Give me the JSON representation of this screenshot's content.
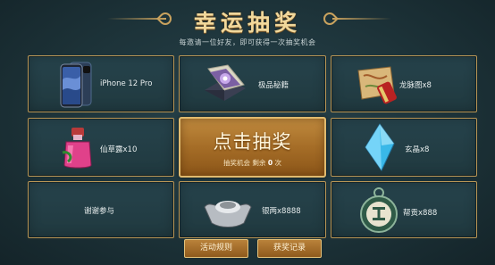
{
  "header": {
    "title": "幸运抽奖",
    "subtitle": "每邀请一位好友，即可获得一次抽奖机会"
  },
  "prizes": [
    {
      "label": "iPhone 12 Pro",
      "icon": "phone-icon"
    },
    {
      "label": "极品秘籍",
      "icon": "secret-book-icon"
    },
    {
      "label": "龙脉图x8",
      "icon": "scroll-map-icon"
    },
    {
      "label": "仙草露x10",
      "icon": "potion-icon"
    },
    {
      "label": "玄晶x8",
      "icon": "crystal-icon"
    },
    {
      "label": "谢谢参与",
      "icon": ""
    },
    {
      "label": "银两x8888",
      "icon": "silver-ingot-icon"
    },
    {
      "label": "帮贡x888",
      "icon": "contribution-token-icon"
    }
  ],
  "draw": {
    "label": "点击抽奖",
    "chances_prefix": "抽奖机会 剩余",
    "chances_count": "0",
    "chances_suffix": "次"
  },
  "footer": {
    "rules_label": "活动规则",
    "records_label": "获奖记录"
  },
  "colors": {
    "background": "#1d3339",
    "border_gold": "#b89656",
    "draw_button": "#a56d27",
    "title": "#f1d89b"
  }
}
